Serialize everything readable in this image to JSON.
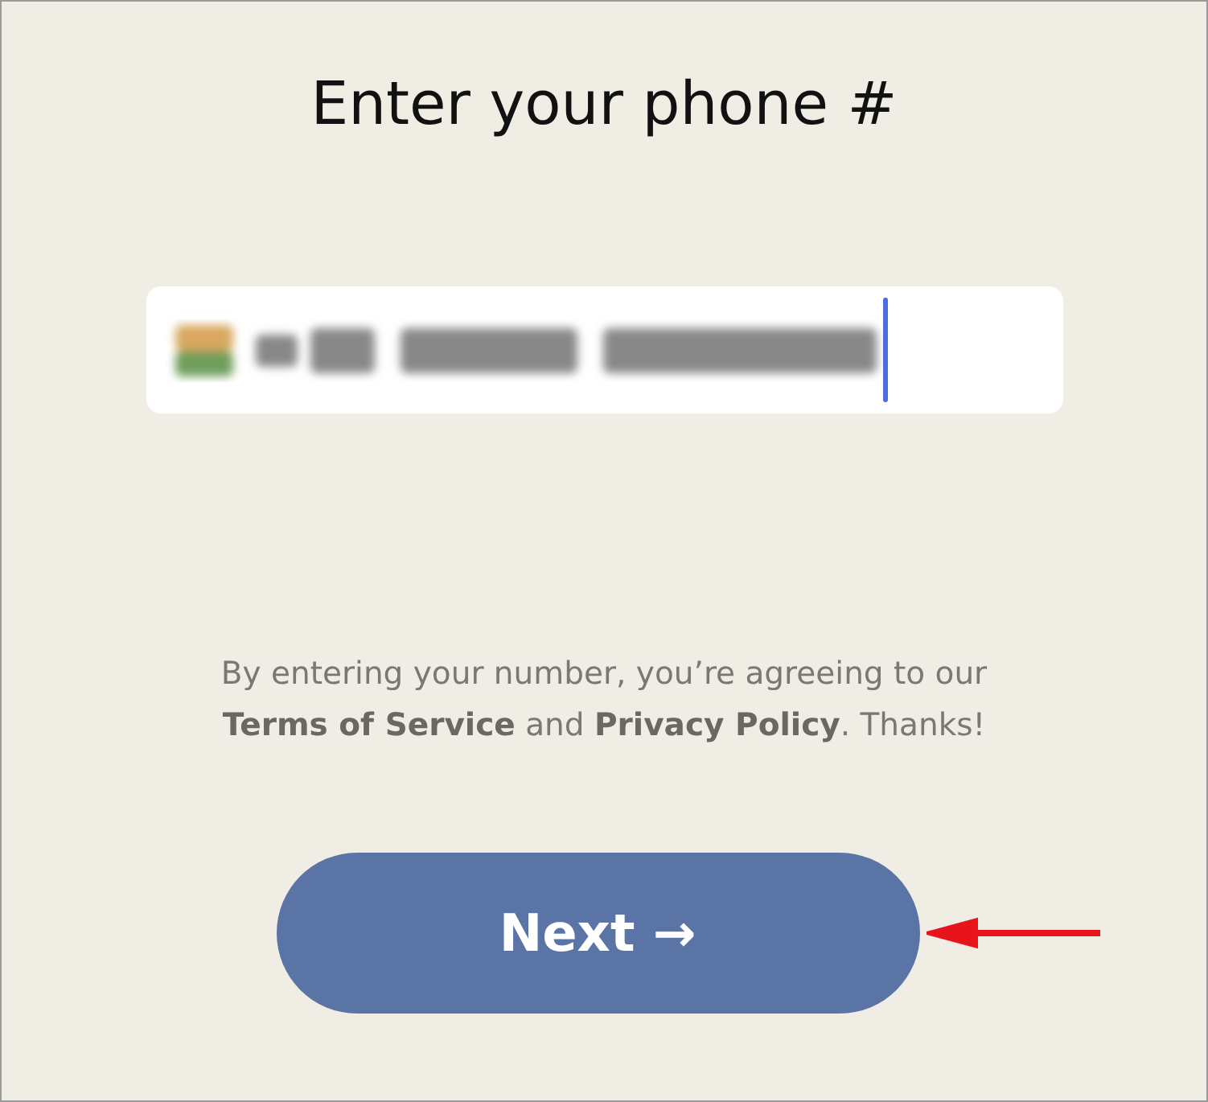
{
  "title": "Enter your phone #",
  "phone_field": {
    "redacted": true,
    "focused": true
  },
  "terms": [
    {
      "kind": "text",
      "text": "By entering your number, you’re agreeing to our "
    },
    {
      "kind": "link",
      "text": "Terms of Service"
    },
    {
      "kind": "text",
      "text": " and "
    },
    {
      "kind": "link",
      "text": "Privacy Policy"
    },
    {
      "kind": "text",
      "text": ". Thanks!"
    }
  ],
  "next_button": {
    "label": "Next →"
  }
}
